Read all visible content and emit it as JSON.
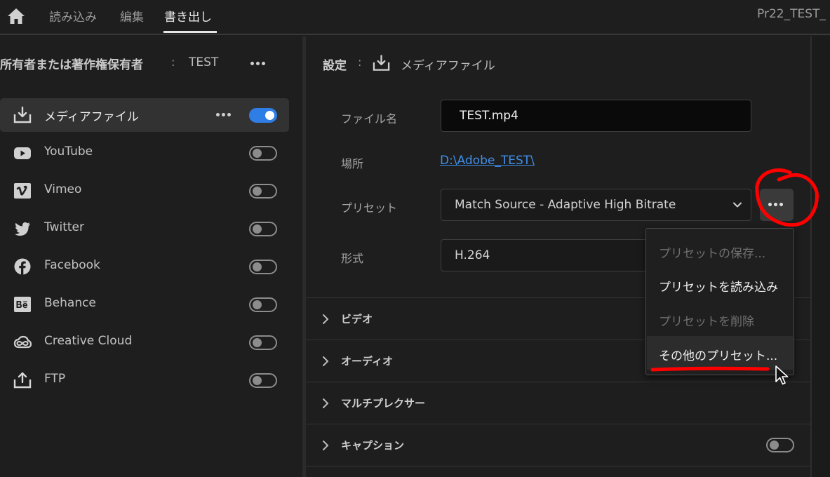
{
  "topbar": {
    "tabs": [
      {
        "label": "読み込み",
        "active": false
      },
      {
        "label": "編集",
        "active": false
      },
      {
        "label": "書き出し",
        "active": true
      }
    ],
    "project_name": "Pr22_TEST_"
  },
  "left_panel": {
    "owner_label": "所有者または著作権保有者",
    "owner_colon": ":",
    "owner_value": "TEST",
    "destinations": [
      {
        "label": "メディアファイル",
        "icon": "download-icon",
        "enabled": true,
        "selected": true
      },
      {
        "label": "YouTube",
        "icon": "youtube-icon",
        "enabled": false,
        "selected": false
      },
      {
        "label": "Vimeo",
        "icon": "vimeo-icon",
        "enabled": false,
        "selected": false
      },
      {
        "label": "Twitter",
        "icon": "twitter-icon",
        "enabled": false,
        "selected": false
      },
      {
        "label": "Facebook",
        "icon": "facebook-icon",
        "enabled": false,
        "selected": false
      },
      {
        "label": "Behance",
        "icon": "behance-icon",
        "enabled": false,
        "selected": false
      },
      {
        "label": "Creative Cloud",
        "icon": "creative-cloud-icon",
        "enabled": false,
        "selected": false
      },
      {
        "label": "FTP",
        "icon": "upload-icon",
        "enabled": false,
        "selected": false
      }
    ]
  },
  "settings": {
    "title": "設定",
    "colon": ":",
    "destination": "メディアファイル",
    "filename_label": "ファイル名",
    "filename_value": "TEST.mp4",
    "location_label": "場所",
    "location_value": "D:\\Adobe_TEST\\",
    "preset_label": "プリセット",
    "preset_value": "Match Source - Adaptive High Bitrate",
    "format_label": "形式",
    "format_value": "H.264",
    "sections": [
      {
        "label": "ビデオ"
      },
      {
        "label": "オーディオ"
      },
      {
        "label": "マルチプレクサー"
      },
      {
        "label": "キャプション",
        "toggle": false
      }
    ]
  },
  "preset_menu": {
    "items": [
      {
        "label": "プリセットの保存...",
        "enabled": false
      },
      {
        "label": "プリセットを読み込み",
        "enabled": true
      },
      {
        "label": "プリセットを削除",
        "enabled": false
      },
      {
        "label": "その他のプリセット...",
        "enabled": true
      }
    ]
  },
  "colors": {
    "accent": "#2f7ee6",
    "link": "#3f8fe8",
    "annotation": "#ff0000",
    "background": "#1e1e1e"
  }
}
